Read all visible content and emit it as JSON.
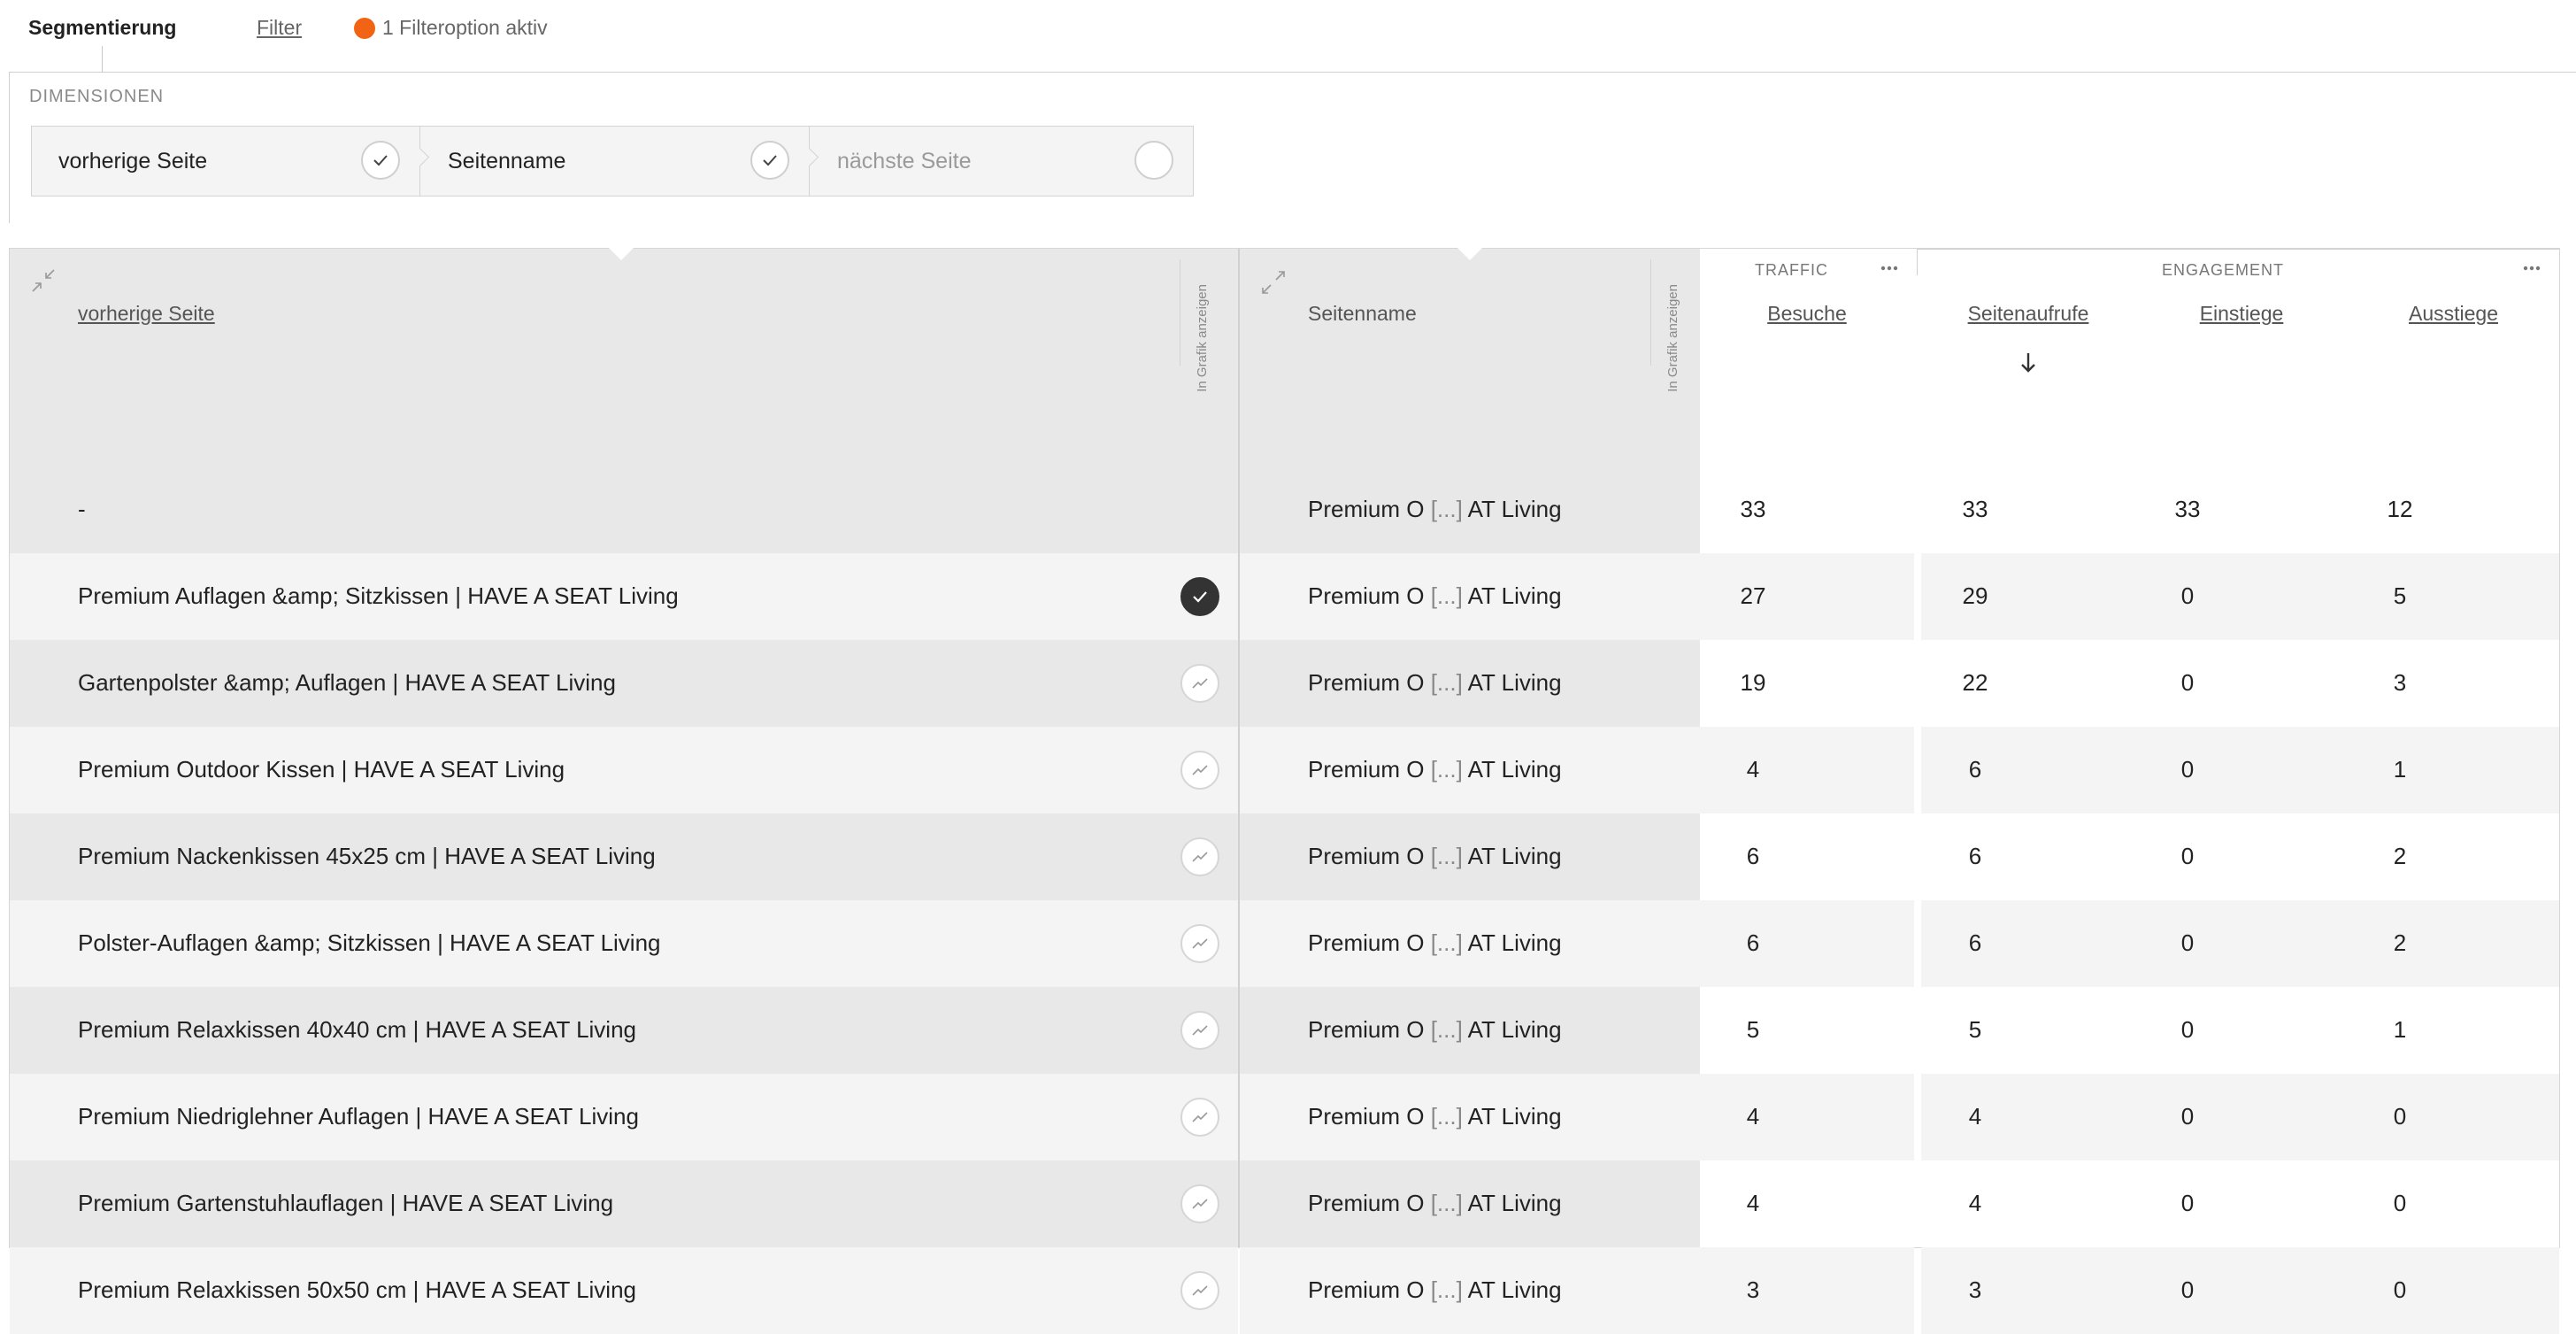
{
  "topbar": {
    "segment_tab": "Segmentierung",
    "filter_tab": "Filter",
    "filter_status": "1 Filteroption aktiv",
    "filter_dot_color": "#f06414"
  },
  "dimensions": {
    "title": "DIMENSIONEN",
    "steps": [
      {
        "label": "vorherige Seite",
        "checked": true
      },
      {
        "label": "Seitenname",
        "checked": true
      },
      {
        "label": "nächste Seite",
        "checked": false
      }
    ]
  },
  "table": {
    "col_prev_page": "vorherige Seite",
    "col_page_name": "Seitenname",
    "show_in_chart": "In Grafik anzeigen",
    "group_traffic": "TRAFFIC",
    "group_engagement": "ENGAGEMENT",
    "metrics": [
      "Besuche",
      "Seitenaufrufe",
      "Einstiege",
      "Ausstiege"
    ],
    "sorted_metric": "Seitenaufrufe",
    "rows": [
      {
        "prev": "-",
        "page_a": "Premium O",
        "page_trunc": "[...]",
        "page_b": "AT Living",
        "besuche": "33",
        "seitenaufrufe": "33",
        "einstiege": "33",
        "ausstiege": "12",
        "chart": "none"
      },
      {
        "prev": "Premium Auflagen &amp; Sitzkissen | HAVE A SEAT Living",
        "page_a": "Premium O",
        "page_trunc": "[...]",
        "page_b": "AT Living",
        "besuche": "27",
        "seitenaufrufe": "29",
        "einstiege": "0",
        "ausstiege": "5",
        "chart": "active"
      },
      {
        "prev": "Gartenpolster &amp; Auflagen | HAVE A SEAT Living",
        "page_a": "Premium O",
        "page_trunc": "[...]",
        "page_b": "AT Living",
        "besuche": "19",
        "seitenaufrufe": "22",
        "einstiege": "0",
        "ausstiege": "3",
        "chart": "inactive"
      },
      {
        "prev": "Premium Outdoor Kissen | HAVE A SEAT Living",
        "page_a": "Premium O",
        "page_trunc": "[...]",
        "page_b": "AT Living",
        "besuche": "4",
        "seitenaufrufe": "6",
        "einstiege": "0",
        "ausstiege": "1",
        "chart": "inactive"
      },
      {
        "prev": "Premium Nackenkissen 45x25 cm | HAVE A SEAT Living",
        "page_a": "Premium O",
        "page_trunc": "[...]",
        "page_b": "AT Living",
        "besuche": "6",
        "seitenaufrufe": "6",
        "einstiege": "0",
        "ausstiege": "2",
        "chart": "inactive"
      },
      {
        "prev": "Polster-Auflagen &amp; Sitzkissen | HAVE A SEAT Living",
        "page_a": "Premium O",
        "page_trunc": "[...]",
        "page_b": "AT Living",
        "besuche": "6",
        "seitenaufrufe": "6",
        "einstiege": "0",
        "ausstiege": "2",
        "chart": "inactive"
      },
      {
        "prev": "Premium Relaxkissen 40x40 cm | HAVE A SEAT Living",
        "page_a": "Premium O",
        "page_trunc": "[...]",
        "page_b": "AT Living",
        "besuche": "5",
        "seitenaufrufe": "5",
        "einstiege": "0",
        "ausstiege": "1",
        "chart": "inactive"
      },
      {
        "prev": "Premium Niedriglehner Auflagen | HAVE A SEAT Living",
        "page_a": "Premium O",
        "page_trunc": "[...]",
        "page_b": "AT Living",
        "besuche": "4",
        "seitenaufrufe": "4",
        "einstiege": "0",
        "ausstiege": "0",
        "chart": "inactive"
      },
      {
        "prev": "Premium Gartenstuhlauflagen | HAVE A SEAT Living",
        "page_a": "Premium O",
        "page_trunc": "[...]",
        "page_b": "AT Living",
        "besuche": "4",
        "seitenaufrufe": "4",
        "einstiege": "0",
        "ausstiege": "0",
        "chart": "inactive"
      },
      {
        "prev": "Premium Relaxkissen 50x50 cm | HAVE A SEAT Living",
        "page_a": "Premium O",
        "page_trunc": "[...]",
        "page_b": "AT Living",
        "besuche": "3",
        "seitenaufrufe": "3",
        "einstiege": "0",
        "ausstiege": "0",
        "chart": "inactive"
      }
    ]
  }
}
